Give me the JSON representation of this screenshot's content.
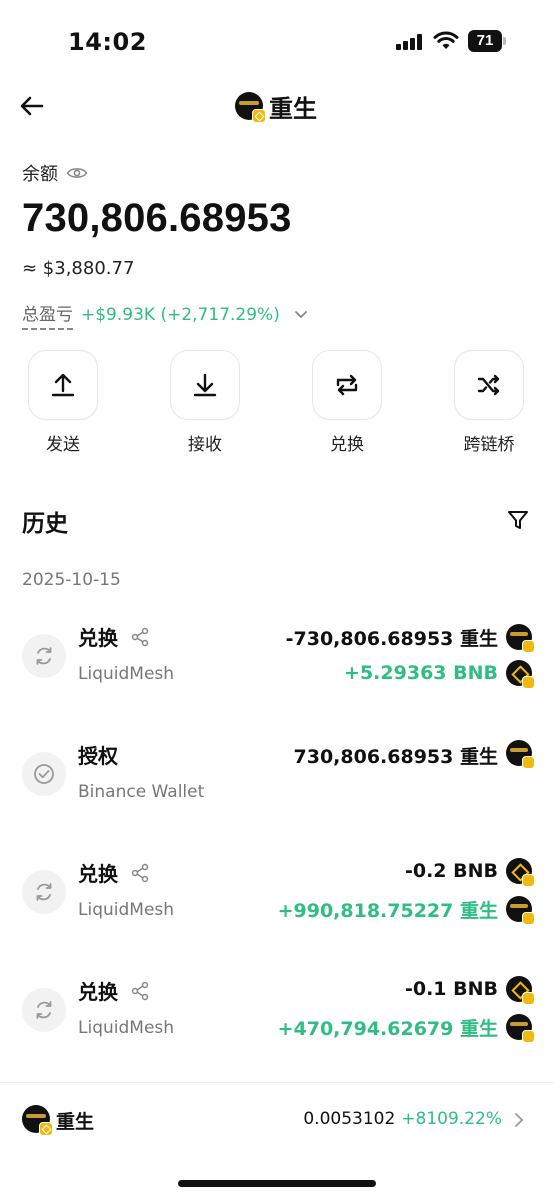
{
  "status_bar": {
    "time": "14:02",
    "battery": "71"
  },
  "header": {
    "title": "重生",
    "logo_icon": "reborn-token-logo"
  },
  "balance": {
    "label": "余额",
    "amount": "730,806.68953",
    "usd": "≈ $3,880.77",
    "pnl_label": "总盈亏",
    "pnl_value": "+$9.93K (+2,717.29%)"
  },
  "actions": [
    {
      "label": "发送",
      "icon": "send-icon"
    },
    {
      "label": "接收",
      "icon": "receive-icon"
    },
    {
      "label": "兑换",
      "icon": "swap-icon"
    },
    {
      "label": "跨链桥",
      "icon": "bridge-icon"
    }
  ],
  "history": {
    "title": "历史",
    "date": "2025-10-15",
    "transactions": [
      {
        "type": "兑换",
        "sub": "LiquidMesh",
        "amounts": [
          {
            "text": "-730,806.68953 重生",
            "coin": "reborn"
          },
          {
            "text": "+5.29363 BNB",
            "coin": "bnb"
          }
        ]
      },
      {
        "type": "授权",
        "sub": "Binance Wallet",
        "amounts": [
          {
            "text": "730,806.68953 重生",
            "coin": "reborn"
          }
        ]
      },
      {
        "type": "兑换",
        "sub": "LiquidMesh",
        "amounts": [
          {
            "text": "-0.2 BNB",
            "coin": "bnb"
          },
          {
            "text": "+990,818.75227 重生",
            "coin": "reborn"
          }
        ]
      },
      {
        "type": "兑换",
        "sub": "LiquidMesh",
        "amounts": [
          {
            "text": "-0.1 BNB",
            "coin": "bnb"
          },
          {
            "text": "+470,794.62679 重生",
            "coin": "reborn"
          }
        ]
      }
    ]
  },
  "bottom_bar": {
    "name": "重生",
    "price": "0.0053102",
    "change": "+8109.22%"
  },
  "colors": {
    "positive": "#2fbd85",
    "text": "#111111",
    "muted": "#777777",
    "bnb": "#f0b90b"
  }
}
